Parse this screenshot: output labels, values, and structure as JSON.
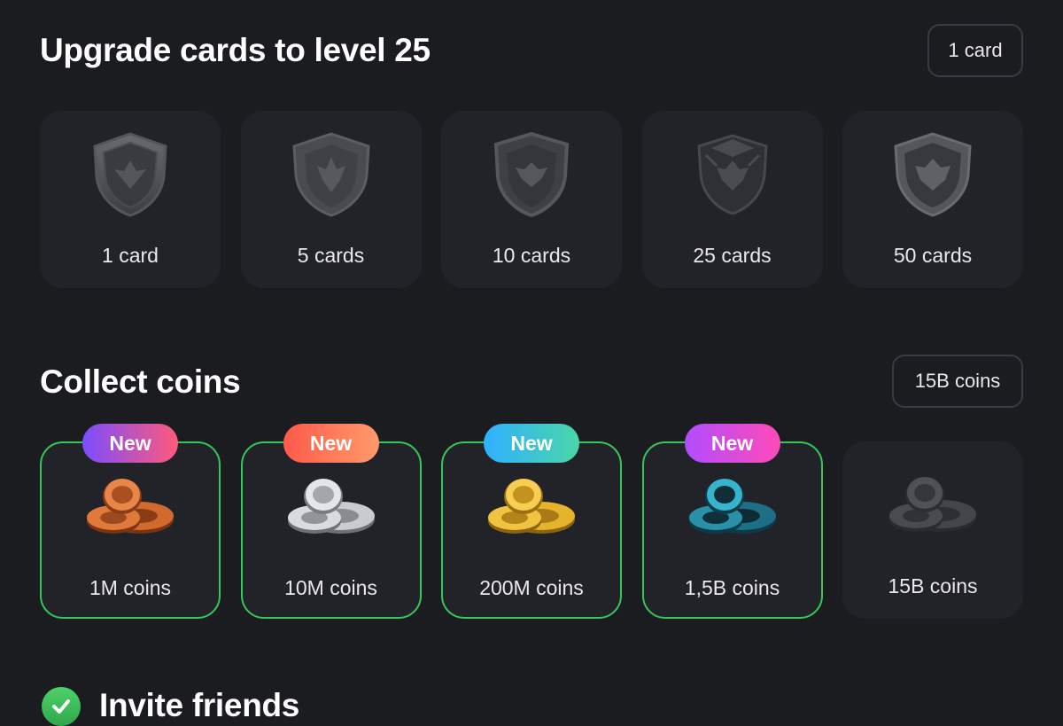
{
  "upgrade_section": {
    "title": "Upgrade cards to level 25",
    "reward_pill": "1 card",
    "tiers": [
      {
        "label": "1 card"
      },
      {
        "label": "5 cards"
      },
      {
        "label": "10 cards"
      },
      {
        "label": "25 cards"
      },
      {
        "label": "50 cards"
      }
    ]
  },
  "coins_section": {
    "title": "Collect coins",
    "reward_pill": "15B coins",
    "tiers": [
      {
        "label": "1M coins",
        "badge": "New",
        "coin_color": "bronze"
      },
      {
        "label": "10M coins",
        "badge": "New",
        "coin_color": "silver"
      },
      {
        "label": "200M coins",
        "badge": "New",
        "coin_color": "gold"
      },
      {
        "label": "1,5B coins",
        "badge": "New",
        "coin_color": "teal"
      },
      {
        "label": "15B coins",
        "coin_color": "dark"
      }
    ]
  },
  "invite_section": {
    "title": "Invite friends",
    "status_icon": "check-circle-icon"
  },
  "colors": {
    "background": "#1b1c20",
    "card": "#222328",
    "active_border": "#34c759",
    "pill_border": "#3a3b42"
  }
}
